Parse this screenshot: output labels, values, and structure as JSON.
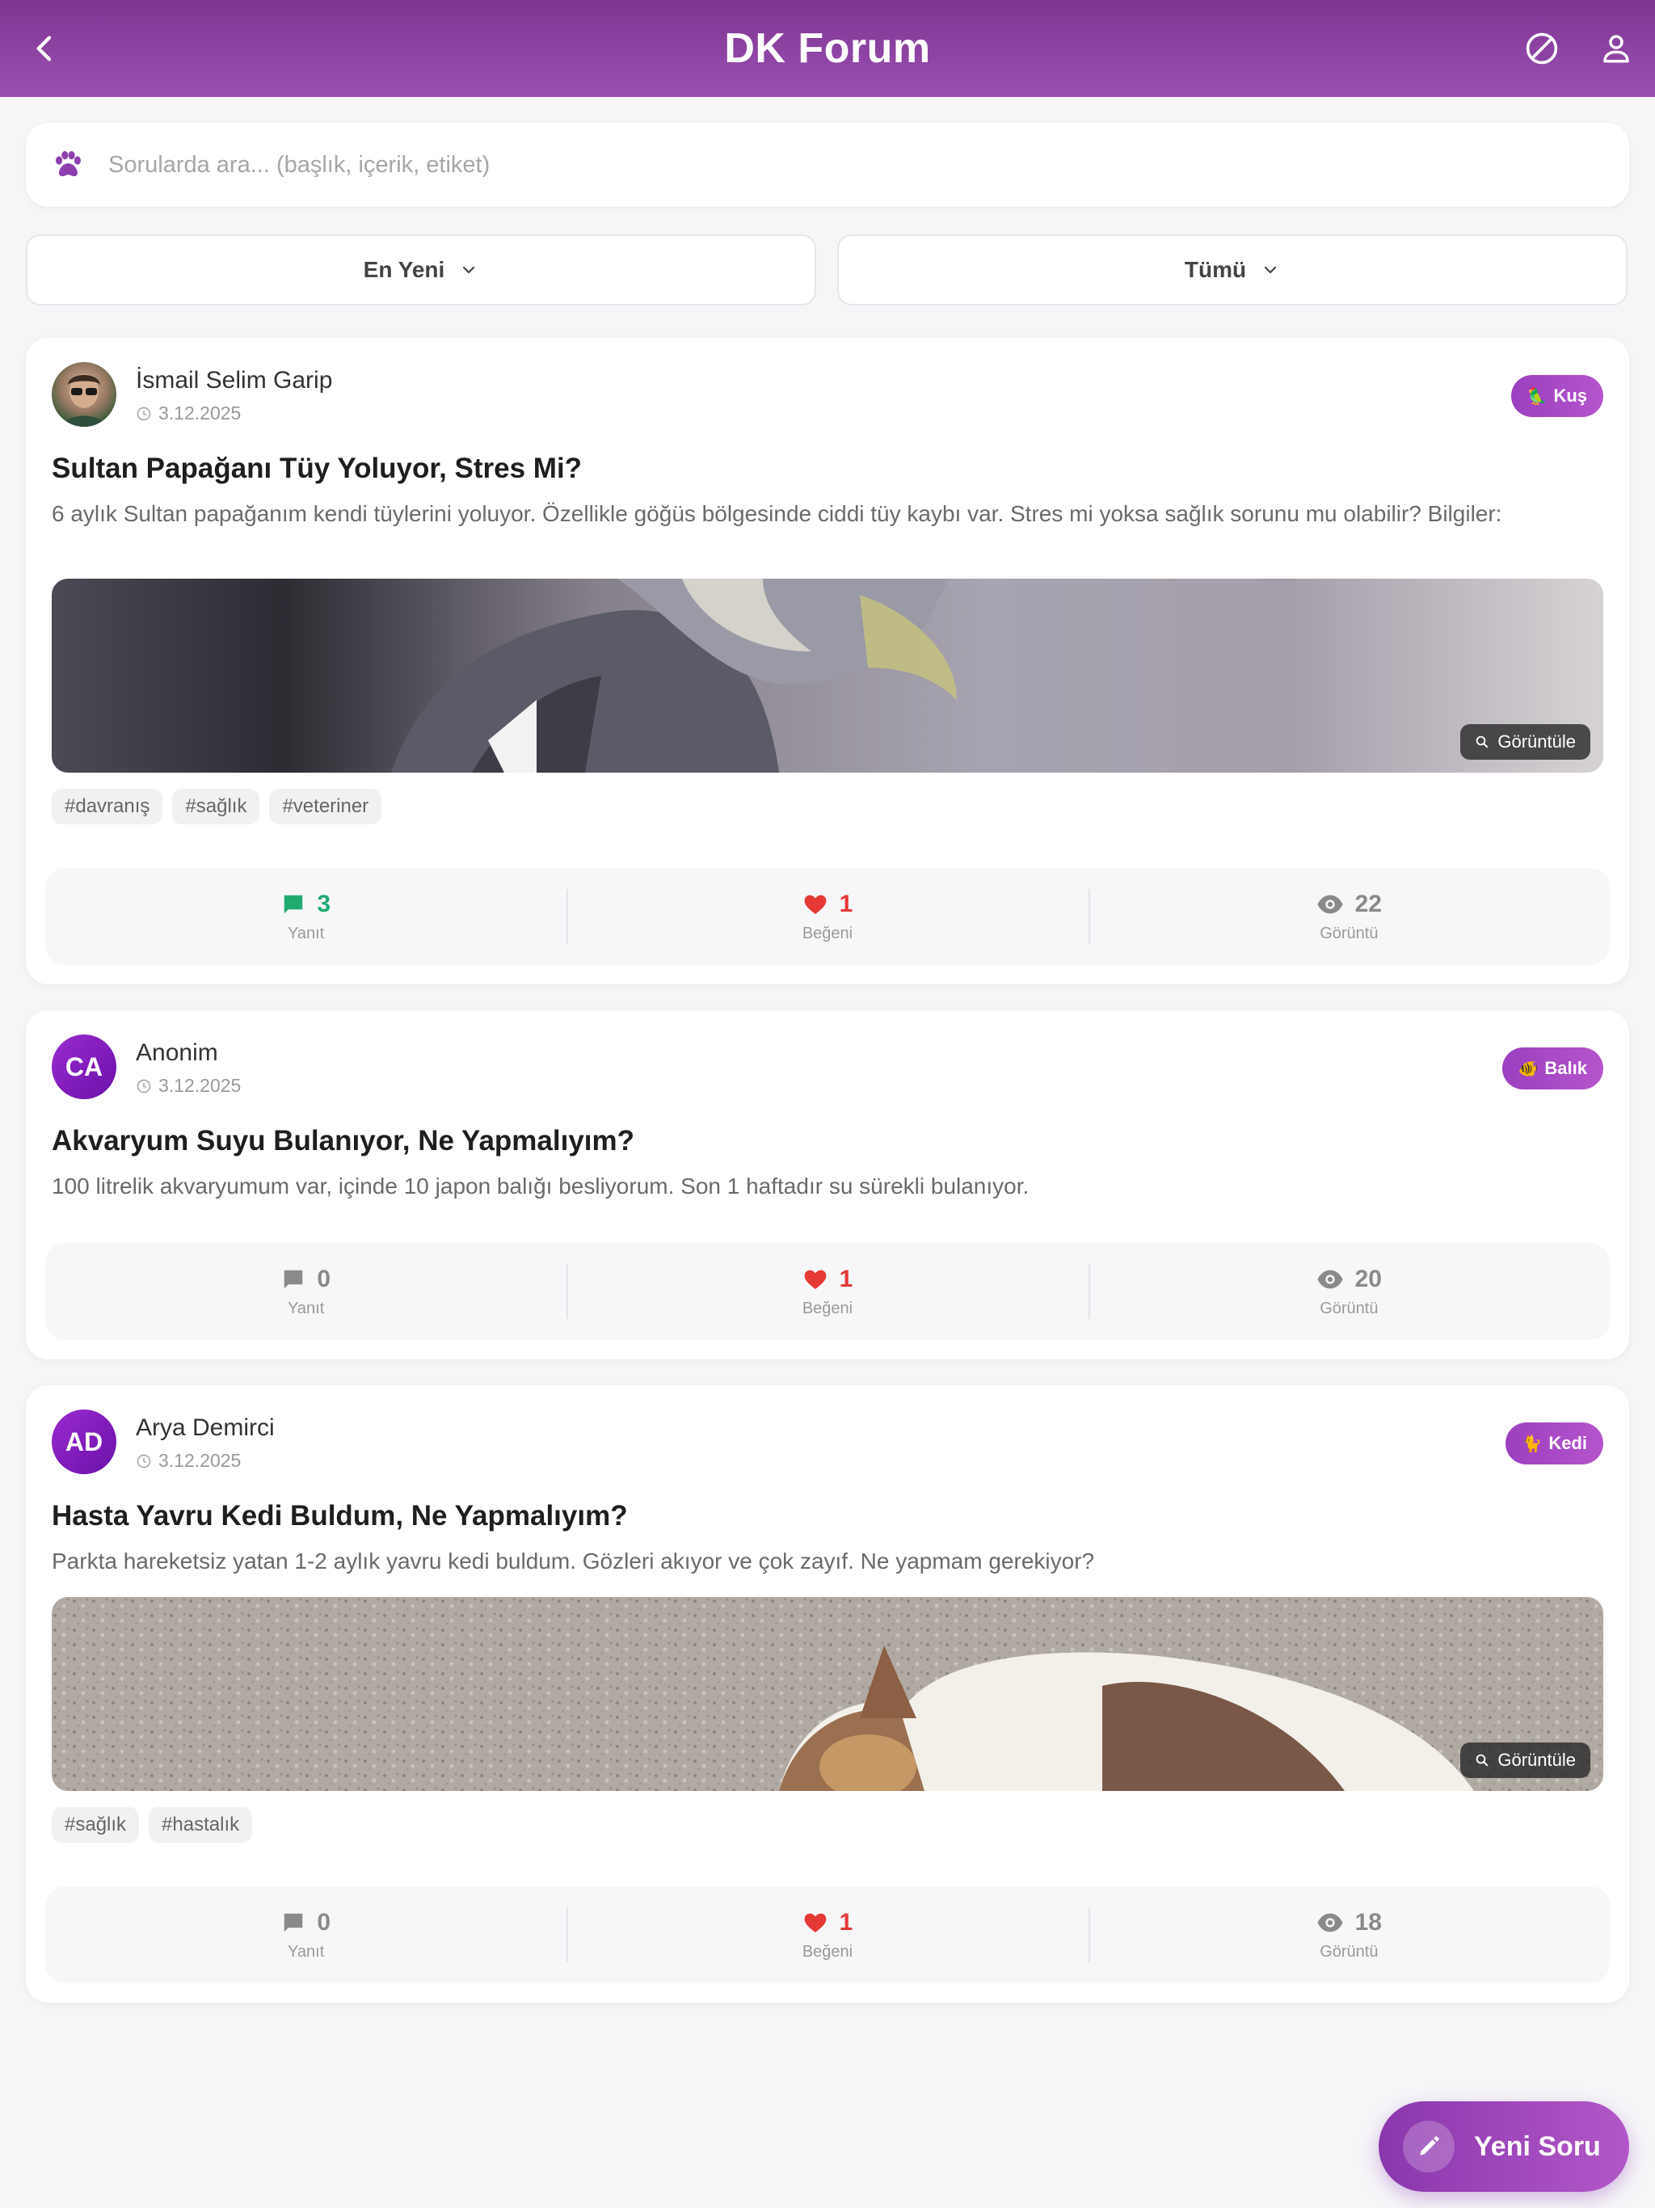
{
  "header": {
    "title": "DK Forum"
  },
  "search": {
    "placeholder": "Sorularda ara... (başlık, içerik, etiket)"
  },
  "filters": {
    "sort_label": "En Yeni",
    "category_label": "Tümü"
  },
  "posts": [
    {
      "author": "İsmail Selim Garip",
      "date": "3.12.2025",
      "avatar_initials": "",
      "category": "Kuş",
      "category_emoji": "🦜",
      "title": "Sultan Papağanı Tüy Yoluyor, Stres Mi?",
      "body": "6 aylık Sultan papağanım kendi tüylerini yoluyor. Özellikle göğüs bölgesinde ciddi tüy kaybı var. Stres mi yoksa sağlık sorunu mu olabilir? Bilgiler:",
      "view_image_label": "Görüntüle",
      "tags": [
        "#davranış",
        "#sağlık",
        "#veteriner"
      ],
      "stats": {
        "replies": "3",
        "replies_label": "Yanıt",
        "likes": "1",
        "likes_label": "Beğeni",
        "views": "22",
        "views_label": "Görüntü"
      }
    },
    {
      "author": "Anonim",
      "date": "3.12.2025",
      "avatar_initials": "CA",
      "category": "Balık",
      "category_emoji": "🐠",
      "title": "Akvaryum Suyu Bulanıyor, Ne Yapmalıyım?",
      "body": "100 litrelik akvaryumum var, içinde 10 japon balığı besliyorum. Son 1 haftadır su sürekli bulanıyor.",
      "stats": {
        "replies": "0",
        "replies_label": "Yanıt",
        "likes": "1",
        "likes_label": "Beğeni",
        "views": "20",
        "views_label": "Görüntü"
      }
    },
    {
      "author": "Arya Demirci",
      "date": "3.12.2025",
      "avatar_initials": "AD",
      "category": "Kedi",
      "category_emoji": "🐈",
      "title": "Hasta Yavru Kedi Buldum, Ne Yapmalıyım?",
      "body": "Parkta hareketsiz yatan 1-2 aylık yavru kedi buldum. Gözleri akıyor ve çok zayıf. Ne yapmam gerekiyor?",
      "view_image_label": "Görüntüle",
      "tags": [
        "#sağlık",
        "#hastalık"
      ],
      "stats": {
        "replies": "0",
        "replies_label": "Yanıt",
        "likes": "1",
        "likes_label": "Beğeni",
        "views": "18",
        "views_label": "Görüntü"
      }
    }
  ],
  "fab": {
    "label": "Yeni Soru"
  },
  "colors": {
    "primary": "#8e3fae",
    "reply_active": "#1faa6f",
    "like": "#e53935",
    "muted": "#8a8a8a"
  }
}
